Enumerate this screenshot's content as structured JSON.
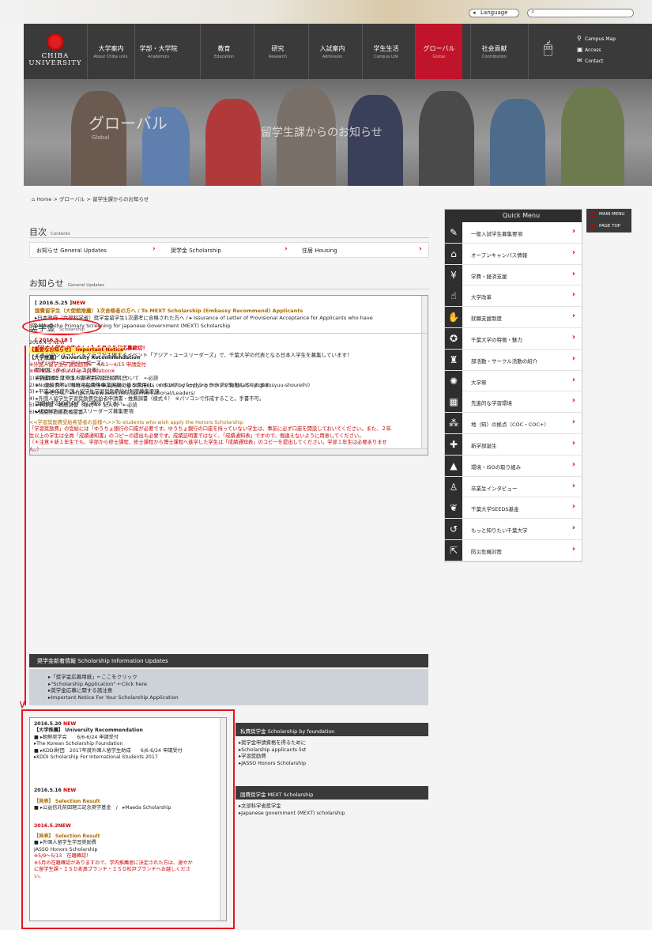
{
  "header": {
    "language_label": "Language",
    "logo_line1": "CHIBA",
    "logo_line2": "UNIVERSITY",
    "nav": [
      {
        "jp": "大学案内",
        "en": "About Chiba univ."
      },
      {
        "jp": "学部・大学院",
        "en": "Academics"
      },
      {
        "jp": "教育",
        "en": "Education"
      },
      {
        "jp": "研究",
        "en": "Research"
      },
      {
        "jp": "入試案内",
        "en": "Admission"
      },
      {
        "jp": "学生生活",
        "en": "Campus Life"
      },
      {
        "jp": "グローバル",
        "en": "Global"
      },
      {
        "jp": "社会貢献",
        "en": "Contribution"
      }
    ],
    "quicklinks": [
      "Campus Map",
      "Access",
      "Contact"
    ]
  },
  "hero": {
    "title": "グローバル",
    "subtitle": "Global",
    "page_name": "留学生課からのお知らせ"
  },
  "breadcrumb": "Home > グローバル > 留学生課からのお知らせ",
  "toc": {
    "title": "目次",
    "title_en": "Contents",
    "items": [
      "お知らせ General Updates",
      "奨学金 Scholarship",
      "住居 Housing"
    ]
  },
  "news": {
    "title": "お知らせ",
    "title_en": "General Updates",
    "date1": "[ 2016.5.25 ]",
    "new1": "NEW",
    "head1": "国費留学生（大使館推薦）1次合格者の方へ / To MEXT Scholarship (Embassy Recommend) Applicants",
    "body1a": "▸日本政府（文部科学省）奨学金留学生1次選考に合格された方へ / ▸ Issurance of Letter of Provisional Acceptance for Applicants who have",
    "body1b": "passed the Primary Screening for Japanese Government (MEXT) Scholarship",
    "date2": "[ 2016.5.18 ]",
    "head2": "【日本人学生の皆さんへ】５月２５日応募締切！",
    "body2a": "イオンワンパーセントクラブが主催するイベント「アジア・ユースリーダーズ」で、千葉大学の代表となる日本人学生を募集しています！",
    "body2b": "「アジア・ユースリーダーズ」",
    "body2c": "開催国：タイ（バンコク市）",
    "body2d": "実施期間：２０１６年８月２１〜２７日",
    "body2e": "※　渡航費等、現地滞在費等事業実施に係る費用は、イオンワンパーセントクラブが負担してくれます",
    "body2f": "参考URL：▸https://www.aeon.info/1p/international/Leaders/",
    "body2g": "詳細は下記のＰＤＦをご確認ください。",
    "body2h": "▸AEONアジア・ユースリーダーズ募集要項"
  },
  "scholarship": {
    "title": "奨学金",
    "title_en": "Scholarship",
    "date": "2016.4.5",
    "new": "NEW",
    "important": "【重要なお知らせ】 Important Notice",
    "rec": "【大学推薦】 University Recommendation",
    "l1": "※外国人留学生学習奨励費※　4/11〜4/15 申請受付",
    "l2": "※Honors Scholarship Application※",
    "l3": "1) ▸平成28年度外国人留学生学習奨励費について　←必読",
    "l4": "2) ▸Notice for all Non-Japanese-speaking Students considering applying Honors Scholarship(gakusyuu-shoureihi)",
    "l5": "3) ▸平成28年度外国人留学生学習奨励費給付制度募集要項",
    "l6": "4) ▸外国人留学生学習奨励費受給者申請書・推薦調書（様式４）　※パソコンで作成すること。手書不可。",
    "l7": "5) ▸申請書・推薦調書（様式４）記入例　←必読",
    "l8": "6) ▸成績評価係数確認書",
    "n1": "<<学習奨励費受給希望者の皆様へ>>To students who wish apply the Honors Scholarship",
    "n2": "「学習奨励費」の受給には「ゆうちょ銀行の口座が必要です。ゆうちょ銀行の口座を持っていない学生は、事前に必ず口座を開設しておいてください。また、２年",
    "n3": "生以上の学生は全員「成績通知書」のコピーの提出も必要です。成績証明書ではなく、「成績通知表」ですので、間違えないように用意してください。",
    "n4": "（＊注意＊新１年生でも、学部から修士課程、修士課程から博士課程へ進学した学生は「成績通知表」のコピーを提出してください。学部１年生は必要ありませ",
    "n5": "ん。）"
  },
  "info": {
    "header": "奨学金新着情報 Scholarship Information Updates",
    "items": [
      "▸「奨学金応募用紙」←ここをクリック",
      "▸\"Scholarship Application\" ←Click here",
      "▸奨学金応募に関する諸注意",
      "▸Important Notice For Your Scholarship Application"
    ]
  },
  "newsbox": {
    "d1": "2016.5.20",
    "new": "NEW",
    "a1": "【大学推薦】 University Recommendation",
    "a2": "■ ▸朝鮮奨学会　　6/6-6/24 申請受付",
    "a3": "▸The Korean Scholarship Foundation",
    "a4": "■ ▸KDDI財団　2017年度外国人留学生助成　　6/6-6/24 申請受付",
    "a5": "▸KDDI Scholarship For International Students 2017",
    "d2": "2016.5.16",
    "b1": "【発表】 Selection Result",
    "b2": "■ ▸公益信託前田理三記念奨学基金　/　▸Maeda Scholarship",
    "d3": "2016.5.2NEW",
    "c1": "【発表】 Selection Result",
    "c2": "■ ▸外国人留学生学習奨励費",
    "c3": "JASSO Honors Scholarship",
    "c4": "※5/9〜5/13　在籍確認！",
    "c5": "※5月の在籍確認がありますので、学内推薦者に決定された方は、速やか",
    "c6": "に留学生課・ＩＳＤ亥鼻ブランチ・ＩＳＤ松戸ブランチへお越しくださ",
    "c7": "い。"
  },
  "private": {
    "header": "私費奨学金 Scholarship by foundation",
    "items": [
      "▸奨学金申請資格を得るために",
      "▸Scholarship applicants list",
      "▸学習奨励費",
      "▸JASSO Honors Scholarship"
    ]
  },
  "mext": {
    "header": "国費奨学金 MEXT Scholarship",
    "items": [
      "▸文部科学省奨学金",
      "▸Japanese government (MEXT) scholarship"
    ]
  },
  "quickmenu": {
    "title": "Quick Menu",
    "items": [
      "一般入試学生募集要項",
      "オープンキャンパス情報",
      "学費・経済支援",
      "大学改革",
      "就職支援制度",
      "千葉大学の特徴・魅力",
      "部活動・サークル活動の紹介",
      "大学祭",
      "先進的な学習環境",
      "地（知）の拠点（COC・COC+）",
      "新学部誕生",
      "環境・ISOの取り組み",
      "卒業生インタビュー",
      "千葉大学SEEDS基金",
      "もっと知りたい千葉大学",
      "防災危機対策"
    ]
  },
  "sidemenu": {
    "main": "MAIN MENU",
    "top": "PAGE TOP"
  }
}
